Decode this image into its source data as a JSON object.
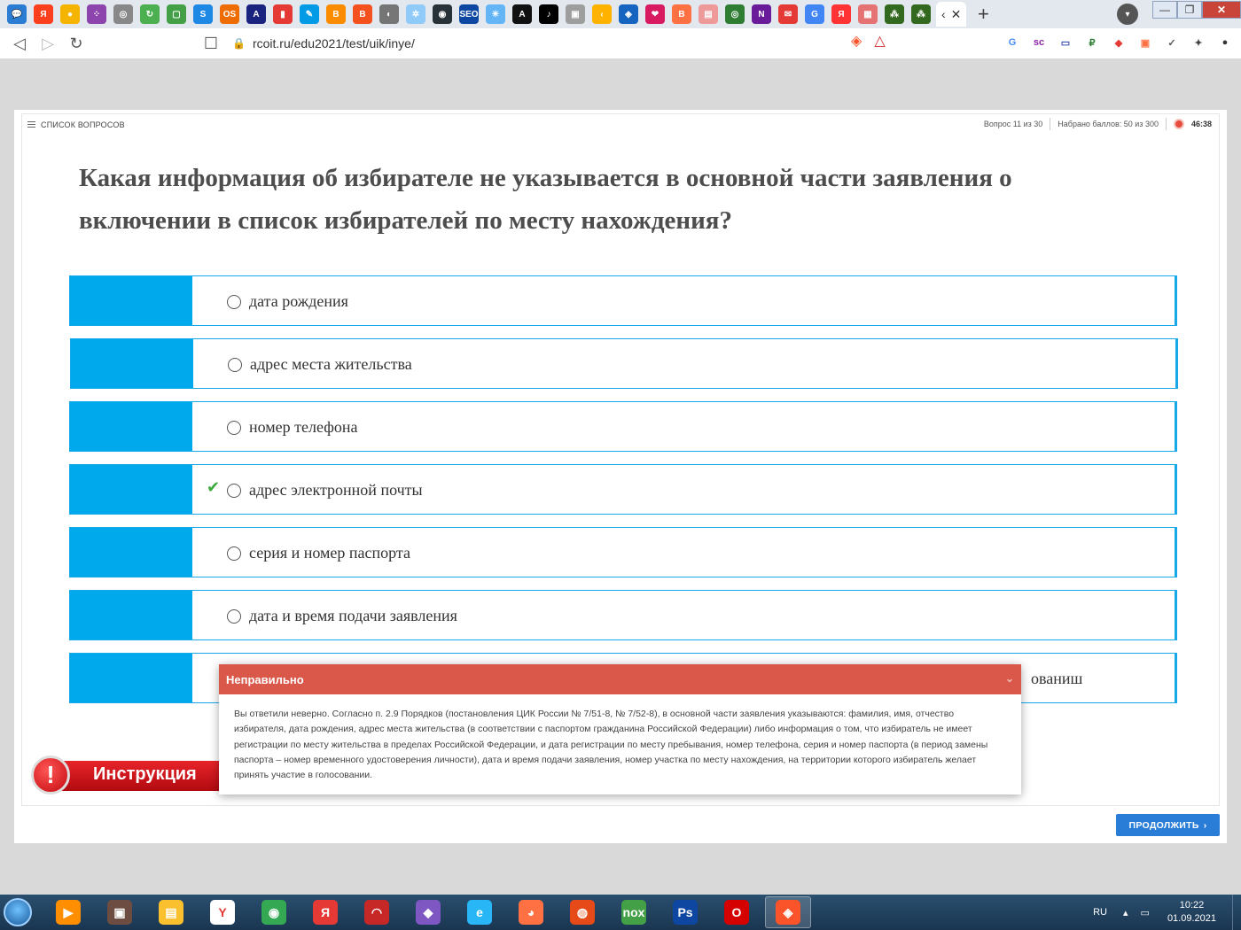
{
  "browser": {
    "url": "rcoit.ru/edu2021/test/uik/inye/",
    "tab_icons": [
      {
        "name": "chat-icon",
        "color": "#2b7cd3",
        "glyph": "💬"
      },
      {
        "name": "yandex-icon",
        "color": "#fc3f1d",
        "glyph": "Я"
      },
      {
        "name": "sphere-icon",
        "color": "#f4b400",
        "glyph": "●"
      },
      {
        "name": "dots-icon",
        "color": "#8e44ad",
        "glyph": "⁘"
      },
      {
        "name": "eye-icon",
        "color": "#888888",
        "glyph": "◎"
      },
      {
        "name": "refresh-green-icon",
        "color": "#4caf50",
        "glyph": "↻"
      },
      {
        "name": "green-app-icon",
        "color": "#43a047",
        "glyph": "▢"
      },
      {
        "name": "serp-icon",
        "color": "#1e88e5",
        "glyph": "S"
      },
      {
        "name": "onlysurf-icon",
        "color": "#ef6c00",
        "glyph": "OS"
      },
      {
        "name": "chart-blue-icon",
        "color": "#1a237e",
        "glyph": "A"
      },
      {
        "name": "bar-chart-icon",
        "color": "#e53935",
        "glyph": "▮"
      },
      {
        "name": "tool-icon",
        "color": "#039be5",
        "glyph": "✎"
      },
      {
        "name": "blogger-icon",
        "color": "#fb8c00",
        "glyph": "B"
      },
      {
        "name": "blogger-alt-icon",
        "color": "#f4511e",
        "glyph": "B"
      },
      {
        "name": "globe-icon",
        "color": "#757575",
        "glyph": "◐"
      },
      {
        "name": "star-icon",
        "color": "#90caf9",
        "glyph": "✲"
      },
      {
        "name": "eye-dark-icon",
        "color": "#263238",
        "glyph": "◉"
      },
      {
        "name": "seo-icon",
        "color": "#0d47a1",
        "glyph": "SEO"
      },
      {
        "name": "spark-icon",
        "color": "#64b5f6",
        "glyph": "✳"
      },
      {
        "name": "a-letter-icon",
        "color": "#111111",
        "glyph": "A"
      },
      {
        "name": "tiktok-icon",
        "color": "#000000",
        "glyph": "♪"
      },
      {
        "name": "cube-icon",
        "color": "#9e9e9e",
        "glyph": "▣"
      },
      {
        "name": "arrow-left-tab-icon",
        "color": "#ffb300",
        "glyph": "‹"
      },
      {
        "name": "shield-blue-icon",
        "color": "#1565c0",
        "glyph": "◈"
      },
      {
        "name": "heart-icon",
        "color": "#d81b60",
        "glyph": "❤"
      },
      {
        "name": "blogger-orange-icon",
        "color": "#ff7043",
        "glyph": "B"
      },
      {
        "name": "bookmark-red-icon",
        "color": "#ef9a9a",
        "glyph": "▤"
      },
      {
        "name": "circle-green-icon",
        "color": "#2e7d32",
        "glyph": "◎"
      },
      {
        "name": "n-letter-icon",
        "color": "#6a1b9a",
        "glyph": "N"
      },
      {
        "name": "mail-red-icon",
        "color": "#e53935",
        "glyph": "✉"
      },
      {
        "name": "google-icon",
        "color": "#4285f4",
        "glyph": "G"
      },
      {
        "name": "yandex-red-icon",
        "color": "#ff3333",
        "glyph": "Я"
      },
      {
        "name": "grid-red-icon",
        "color": "#e57373",
        "glyph": "▦"
      },
      {
        "name": "group-green-icon",
        "color": "#33691e",
        "glyph": "⁂"
      },
      {
        "name": "group-green-alt-icon",
        "color": "#33691e",
        "glyph": "⁂"
      }
    ],
    "ext_icons": [
      {
        "name": "translate-icon",
        "color": "#4a8af4",
        "glyph": "G"
      },
      {
        "name": "sc-icon",
        "color": "#8e24aa",
        "glyph": "sc"
      },
      {
        "name": "save-icon",
        "color": "#3f51b5",
        "glyph": "▭"
      },
      {
        "name": "ruble-icon",
        "color": "#2e7d32",
        "glyph": "₽"
      },
      {
        "name": "cube-color-icon",
        "color": "#e53935",
        "glyph": "◆"
      },
      {
        "name": "record-icon",
        "color": "#ff7043",
        "glyph": "▣"
      },
      {
        "name": "shield-check-icon",
        "color": "#555555",
        "glyph": "✓"
      },
      {
        "name": "puzzle-icon",
        "color": "#444444",
        "glyph": "✦"
      },
      {
        "name": "profile-icon",
        "color": "#333333",
        "glyph": "●"
      }
    ]
  },
  "quiz": {
    "question_list_label": "СПИСОК ВОПРОСОВ",
    "question_counter": "Вопрос 11 из 30",
    "score": "Набрано баллов: 50 из 300",
    "timer": "46:38",
    "question": "Какая информация об избирателе не указывается в основной части заявления о включении в список избирателей по месту нахождения?",
    "answers": [
      {
        "text": "дата рождения"
      },
      {
        "text": "адрес места жительства"
      },
      {
        "text": "номер телефона"
      },
      {
        "text": "адрес электронной почты"
      },
      {
        "text": "серия и номер паспорта"
      },
      {
        "text": "дата и время подачи заявления"
      },
      {
        "text": "ованиш"
      }
    ],
    "instruction_label": "Инструкция",
    "continue_label": "ПРОДОЛЖИТЬ"
  },
  "popup": {
    "title": "Неправильно",
    "body": "Вы ответили неверно. Согласно п. 2.9 Порядков (постановления ЦИК России № 7/51-8, № 7/52-8), в основной части заявления указываются: фамилия, имя, отчество избирателя, дата рождения, адрес места жительства (в соответствии с паспортом гражданина Российской Федерации) либо информация о том, что избиратель не имеет регистрации по месту жительства в пределах Российской Федерации, и дата регистрации по месту пребывания, номер телефона, серия и номер паспорта (в период замены паспорта – номер временного удостоверения личности), дата и время подачи заявления, номер участка по месту нахождения, на территории которого избиратель желает принять участие в голосовании."
  },
  "taskbar": {
    "apps": [
      {
        "name": "media-player-icon",
        "color": "#ff8f00",
        "glyph": "▶"
      },
      {
        "name": "photo-viewer-icon",
        "color": "#6d4c41",
        "glyph": "▣"
      },
      {
        "name": "explorer-icon",
        "color": "#fbc02d",
        "glyph": "▤"
      },
      {
        "name": "yandex-browser-icon",
        "color": "#ffffff",
        "glyph": "Y"
      },
      {
        "name": "chrome-icon",
        "color": "#34a853",
        "glyph": "◉"
      },
      {
        "name": "yandex-taskbar-icon",
        "color": "#e53935",
        "glyph": "Я"
      },
      {
        "name": "speed-icon",
        "color": "#c62828",
        "glyph": "◠"
      },
      {
        "name": "gem-icon",
        "color": "#7e57c2",
        "glyph": "◆"
      },
      {
        "name": "ie-icon",
        "color": "#29b6f6",
        "glyph": "e"
      },
      {
        "name": "firefox-icon",
        "color": "#ff7043",
        "glyph": "◕"
      },
      {
        "name": "bird-icon",
        "color": "#e64a19",
        "glyph": "◍"
      },
      {
        "name": "nox-icon",
        "color": "#43a047",
        "glyph": "nox"
      },
      {
        "name": "photoshop-icon",
        "color": "#0d47a1",
        "glyph": "Ps"
      },
      {
        "name": "opera-icon",
        "color": "#d50000",
        "glyph": "O"
      },
      {
        "name": "brave-icon",
        "color": "#fb542b",
        "glyph": "◈"
      }
    ],
    "lang": "RU",
    "time": "10:22",
    "date": "01.09.2021"
  }
}
